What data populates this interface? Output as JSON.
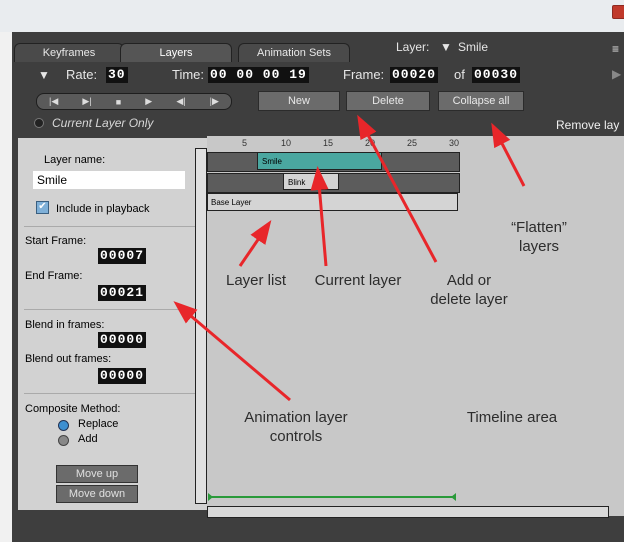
{
  "tabs": [
    "Keyframes",
    "Layers",
    "Animation Sets"
  ],
  "layer_selector": {
    "label": "Layer:",
    "value": "Smile"
  },
  "rate": {
    "label": "Rate:",
    "value": "30"
  },
  "time": {
    "label": "Time:",
    "value": "00 00 00 19"
  },
  "frame": {
    "label": "Frame:",
    "value": "00020",
    "of_label": "of",
    "total": "00030"
  },
  "transport": [
    "|◀",
    "▶|",
    "■",
    "▶",
    "◀|",
    "|▶"
  ],
  "buttons": {
    "new": "New",
    "delete": "Delete",
    "collapse": "Collapse all"
  },
  "current_layer_only": "Current Layer Only",
  "remove_layer": "Remove lay",
  "left": {
    "layer_name_label": "Layer name:",
    "layer_name_value": "Smile",
    "include_label": "Include in playback",
    "start_frame_label": "Start Frame:",
    "start_frame_value": "00007",
    "end_frame_label": "End Frame:",
    "end_frame_value": "00021",
    "blend_in_label": "Blend in frames:",
    "blend_in_value": "00000",
    "blend_out_label": "Blend  out frames:",
    "blend_out_value": "00000",
    "composite_label": "Composite Method:",
    "replace_label": "Replace",
    "add_label": "Add",
    "move_up": "Move up",
    "move_down": "Move down"
  },
  "ruler": [
    "5",
    "10",
    "15",
    "20",
    "25",
    "30"
  ],
  "layers": [
    {
      "name": "Smile",
      "start": 7,
      "end": 21,
      "color": "#4aa7a0"
    },
    {
      "name": "Blink",
      "start": 12,
      "end": 17,
      "color": "#d4d4d4"
    },
    {
      "name": "Base Layer",
      "start": 0,
      "end": 30,
      "color": "#d4d4d4"
    }
  ],
  "annotations": {
    "flatten_1": "“Flatten”",
    "flatten_2": "layers",
    "layer_list": "Layer list",
    "current_layer": "Current layer",
    "add_delete_1": "Add or",
    "add_delete_2": "delete layer",
    "anim_controls_1": "Animation layer",
    "anim_controls_2": "controls",
    "timeline_area": "Timeline area"
  },
  "colors": {
    "accent_layer": "#4aa7a0",
    "arrow": "#e8262a"
  }
}
